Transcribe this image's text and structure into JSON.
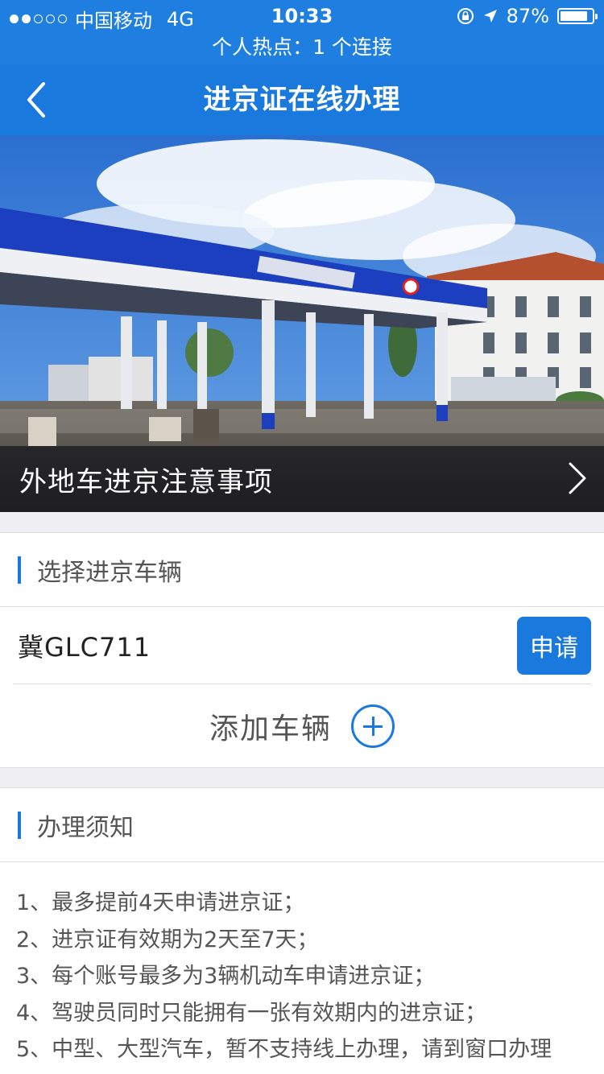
{
  "status_bar": {
    "carrier": "中国移动",
    "network": "4G",
    "time": "10:33",
    "battery_percent": "87%",
    "battery_level": 0.87
  },
  "hotspot": {
    "text": "个人热点：1 个连接"
  },
  "navbar": {
    "title": "进京证在线办理"
  },
  "banner": {
    "caption": "外地车进京注意事项"
  },
  "vehicles": {
    "section_title": "选择进京车辆",
    "items": [
      {
        "plate": "冀GLC711",
        "apply_label": "申请"
      }
    ],
    "add_label": "添加车辆"
  },
  "notice": {
    "section_title": "办理须知",
    "items": [
      "1、最多提前4天申请进京证；",
      "2、进京证有效期为2天至7天；",
      "3、每个账号最多为3辆机动车申请进京证；",
      "4、驾驶员同时只能拥有一张有效期内的进京证；",
      "5、中型、大型汽车，暂不支持线上办理，请到窗口办理"
    ]
  },
  "colors": {
    "accent": "#1a79dd",
    "status_bar": "#1f7fe0",
    "background": "#efeff4"
  }
}
